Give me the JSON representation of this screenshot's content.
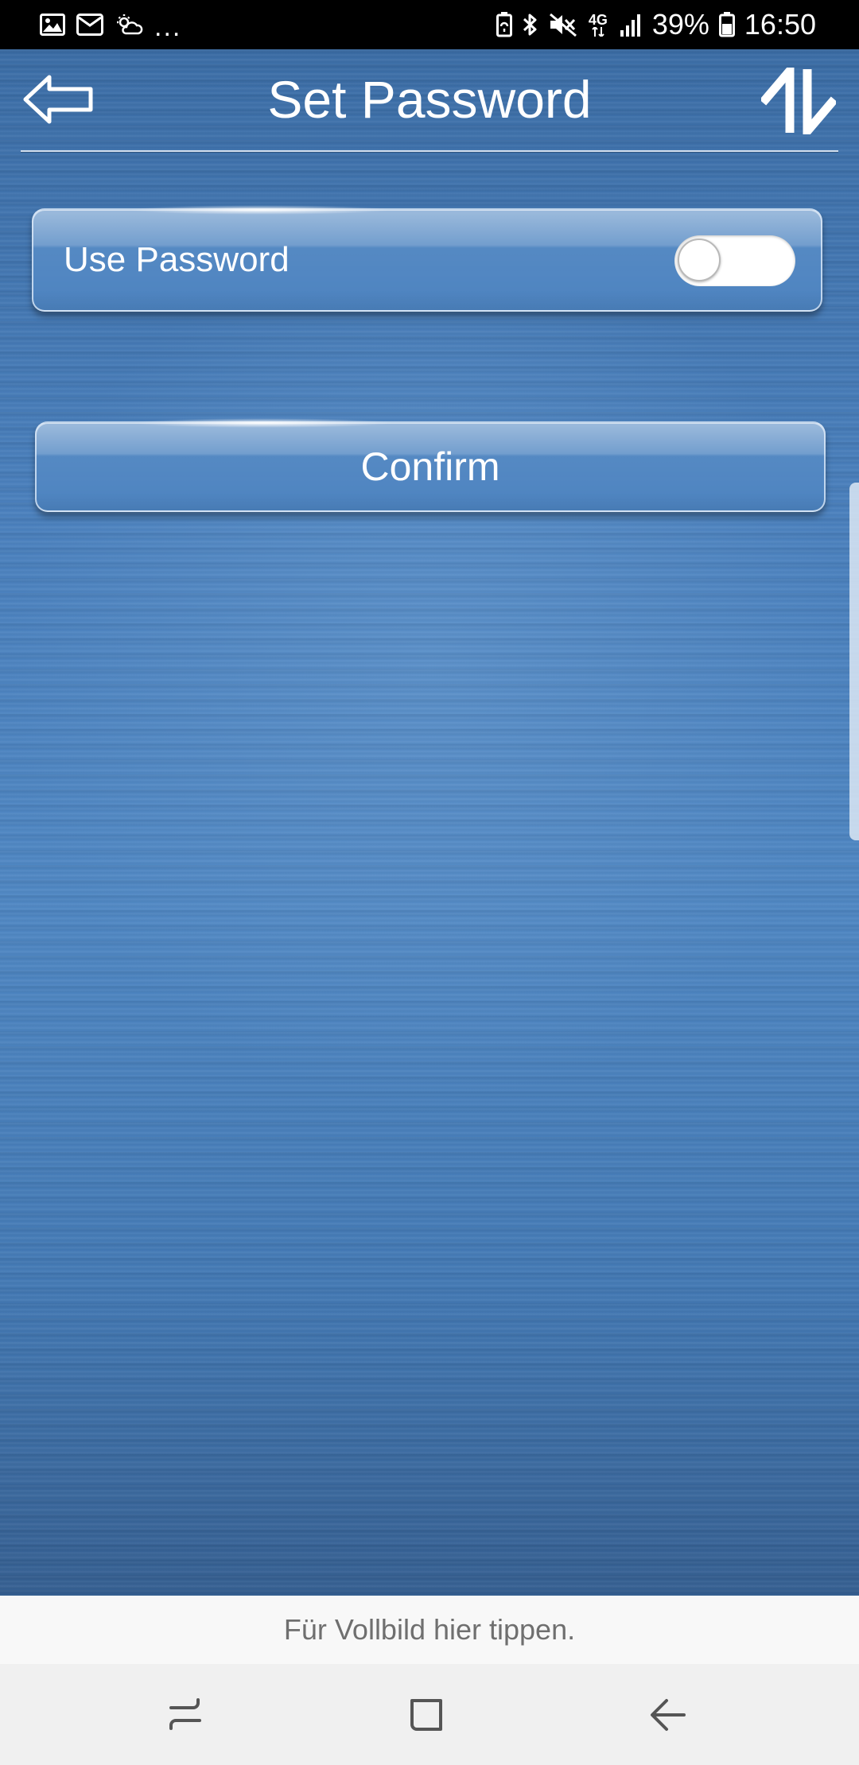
{
  "status_bar": {
    "left_icons": [
      "gallery-icon",
      "email-icon",
      "weather-icon"
    ],
    "overflow": "...",
    "right_icons": [
      "battery-saver-icon",
      "bluetooth-icon",
      "mute-icon"
    ],
    "network_label": "4G",
    "signal_icon": "signal-icon",
    "battery": "39%",
    "battery_icon": "battery-icon",
    "time": "16:50"
  },
  "header": {
    "back_icon": "back-arrow-icon",
    "title": "Set Password",
    "sync_icon": "sync-arrows-icon"
  },
  "settings": {
    "use_password": {
      "label": "Use Password",
      "enabled": false
    }
  },
  "actions": {
    "confirm_label": "Confirm"
  },
  "fullscreen_hint": "Für Vollbild hier tippen.",
  "nav_bar": {
    "items": [
      "recents-icon",
      "home-icon",
      "back-icon"
    ]
  },
  "colors": {
    "background": "#4a80bd",
    "text": "#ffffff",
    "hint_bar": "#f8f8f8",
    "nav_bar": "#f0f0f0"
  }
}
